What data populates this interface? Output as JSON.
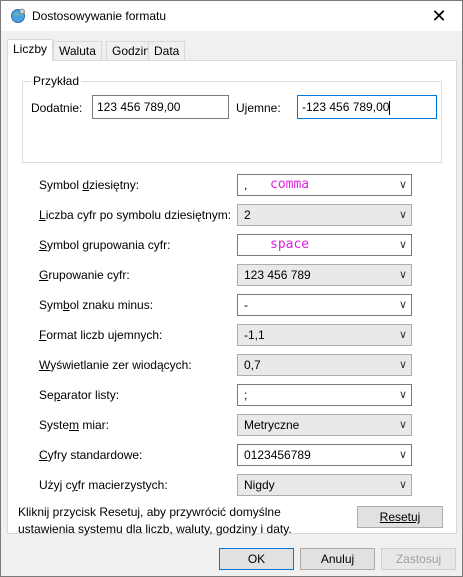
{
  "window": {
    "title": "Dostosowywanie formatu",
    "close_glyph": "✕"
  },
  "tabs": [
    {
      "label": "Liczby",
      "active": true
    },
    {
      "label": "Waluta",
      "active": false
    },
    {
      "label": "Godzina",
      "active": false
    },
    {
      "label": "Data",
      "active": false
    }
  ],
  "example": {
    "group_label": "Przykład",
    "positive_label": "Dodatnie:",
    "positive_value": "123 456 789,00",
    "negative_label": "Ujemne:",
    "negative_value": "-123 456 789,00"
  },
  "settings": [
    {
      "label": "Symbol dziesiętny:",
      "value": ",",
      "note": "comma",
      "editable": true
    },
    {
      "label": "Liczba cyfr po symbolu dziesiętnym:",
      "value": "2",
      "editable": false
    },
    {
      "label": "Symbol grupowania cyfr:",
      "value": "",
      "note": "space",
      "editable": true
    },
    {
      "label": "Grupowanie cyfr:",
      "value": "123 456 789",
      "editable": false
    },
    {
      "label": "Symbol znaku minus:",
      "value": "-",
      "editable": true
    },
    {
      "label": "Format liczb ujemnych:",
      "value": "-1,1",
      "editable": false
    },
    {
      "label": "Wyświetlanie zer wiodących:",
      "value": "0,7",
      "editable": false
    },
    {
      "label": "Separator listy:",
      "value": ";",
      "editable": true
    },
    {
      "label": "System miar:",
      "value": "Metryczne",
      "editable": false
    },
    {
      "label": "Cyfry standardowe:",
      "value": "0123456789",
      "editable": true
    },
    {
      "label": "Użyj cyfr macierzystych:",
      "value": "Nigdy",
      "editable": false
    }
  ],
  "reset": {
    "text": "Kliknij przycisk Resetuj, aby przywrócić domyślne ustawienia systemu dla liczb, waluty, godziny i daty.",
    "button": "Resetuj"
  },
  "footer": {
    "ok": "OK",
    "cancel": "Anuluj",
    "apply": "Zastosuj"
  },
  "colors": {
    "accent": "#0078d7",
    "annotation": "#e020e0"
  },
  "icons": {
    "app": "settings-globe-icon",
    "dropdown": "chevron-down-icon",
    "close": "close-icon"
  }
}
